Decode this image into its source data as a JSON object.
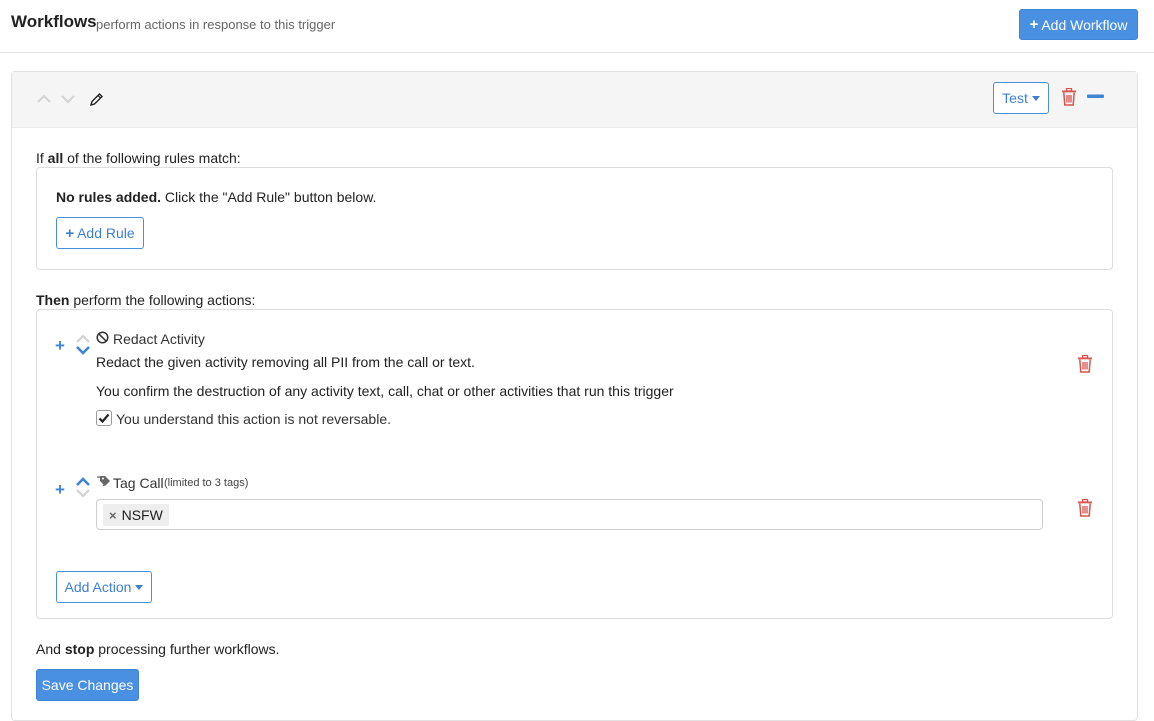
{
  "header": {
    "title": "Workflows",
    "subtitle": "perform actions in response to this trigger",
    "add_workflow_label": "Add Workflow",
    "add_workflow_icon": "plus-icon"
  },
  "workflow": {
    "test_label": "Test",
    "rules_intro_prefix": "If ",
    "rules_intro_bold": "all",
    "rules_intro_suffix": " of the following rules match:",
    "no_rules_bold": "No rules added.",
    "no_rules_text": " Click the \"Add Rule\" button below.",
    "add_rule_label": "Add Rule",
    "actions_intro_bold": "Then",
    "actions_intro_text": " perform the following actions:",
    "actions": [
      {
        "icon": "ban-icon",
        "title": "Redact Activity",
        "description": "Redact the given activity removing all PII from the call or text.",
        "confirm_text": "You confirm the destruction of any activity text, call, chat or other activities that run this trigger",
        "checkbox_label": "You understand this action is not reversable.",
        "checkbox_checked": true
      },
      {
        "icon": "tags-icon",
        "title": "Tag Call",
        "note": "(limited to 3 tags)",
        "tags": [
          "NSFW"
        ]
      }
    ],
    "add_action_label": "Add Action",
    "stop_prefix": "And ",
    "stop_bold": "stop",
    "stop_suffix": " processing further workflows.",
    "save_label": "Save Changes"
  },
  "colors": {
    "primary": "#4a90e2",
    "danger": "#d9534f",
    "muted_chevron": "#cfcfcf"
  }
}
